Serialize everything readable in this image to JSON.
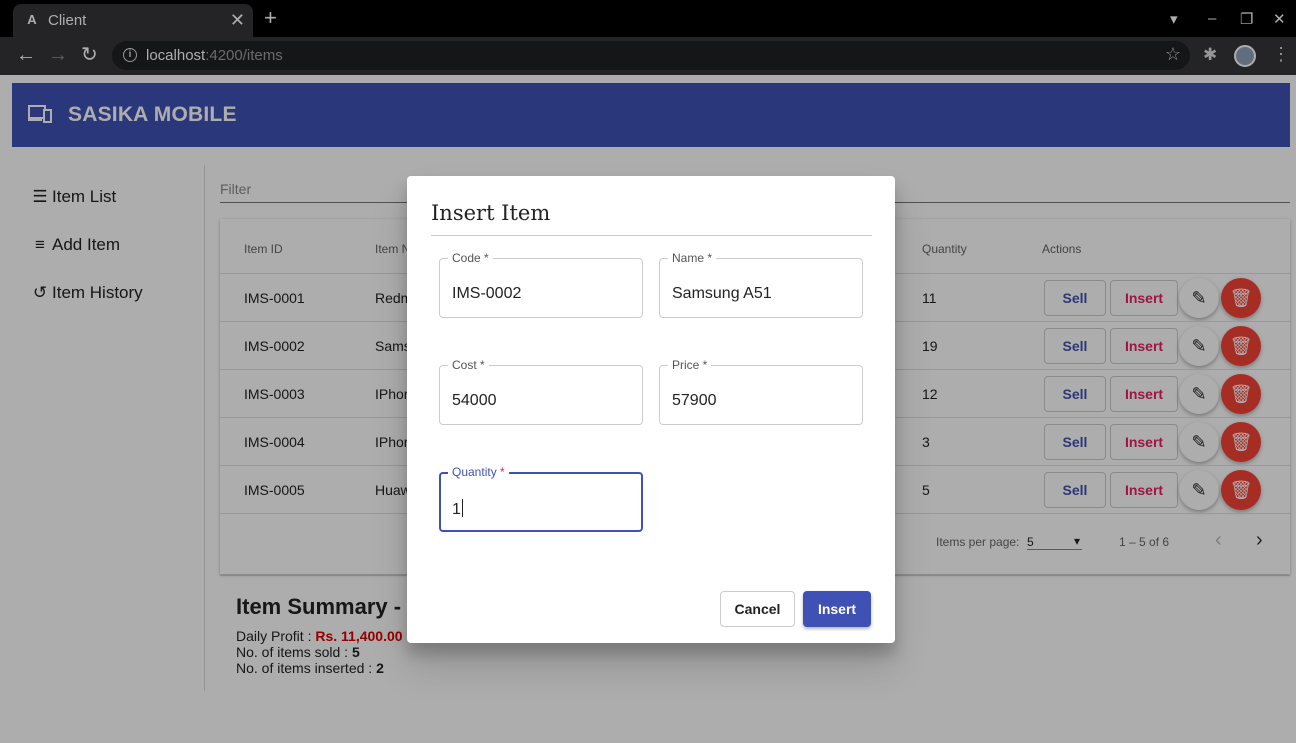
{
  "browser": {
    "tab_title": "Client",
    "url_host": "localhost",
    "url_rest": ":4200/items"
  },
  "app": {
    "brand": "SASIKA MOBILE"
  },
  "sidebar": {
    "items": [
      {
        "label": "Item List",
        "icon": "list-icon"
      },
      {
        "label": "Add Item",
        "icon": "playlist-add-icon"
      },
      {
        "label": "Item History",
        "icon": "history-icon"
      }
    ]
  },
  "filter": {
    "placeholder": "Filter"
  },
  "table": {
    "headers": [
      "Item ID",
      "Item N",
      "Quantity",
      "Actions"
    ],
    "rows": [
      {
        "id": "IMS-0001",
        "name": "Redm",
        "qty": "11"
      },
      {
        "id": "IMS-0002",
        "name": "Sams",
        "qty": "19"
      },
      {
        "id": "IMS-0003",
        "name": "IPhor",
        "qty": "12"
      },
      {
        "id": "IMS-0004",
        "name": "IPhor",
        "qty": "3"
      },
      {
        "id": "IMS-0005",
        "name": "Huaw",
        "qty": "5"
      }
    ],
    "sell_label": "Sell",
    "insert_label": "Insert"
  },
  "paginator": {
    "items_per_page_label": "Items per page:",
    "page_size": "5",
    "range": "1 – 5 of 6"
  },
  "summary": {
    "title": "Item Summary -",
    "daily_profit_label": "Daily Profit :",
    "daily_profit_value": "Rs. 11,400.00",
    "sold_label": "No. of items sold :",
    "sold_value": "5",
    "inserted_label": "No. of items inserted :",
    "inserted_value": "2"
  },
  "dialog": {
    "title": "Insert Item",
    "fields": {
      "code_label": "Code *",
      "code_value": "IMS-0002",
      "name_label": "Name *",
      "name_value": "Samsung A51",
      "cost_label": "Cost *",
      "cost_value": "54000",
      "price_label": "Price *",
      "price_value": "57900",
      "quantity_label": "Quantity",
      "quantity_value": "1"
    },
    "cancel_label": "Cancel",
    "insert_label": "Insert"
  },
  "colors": {
    "primary": "#3f51b5",
    "accent": "#e91e63",
    "warn": "#f44336"
  }
}
